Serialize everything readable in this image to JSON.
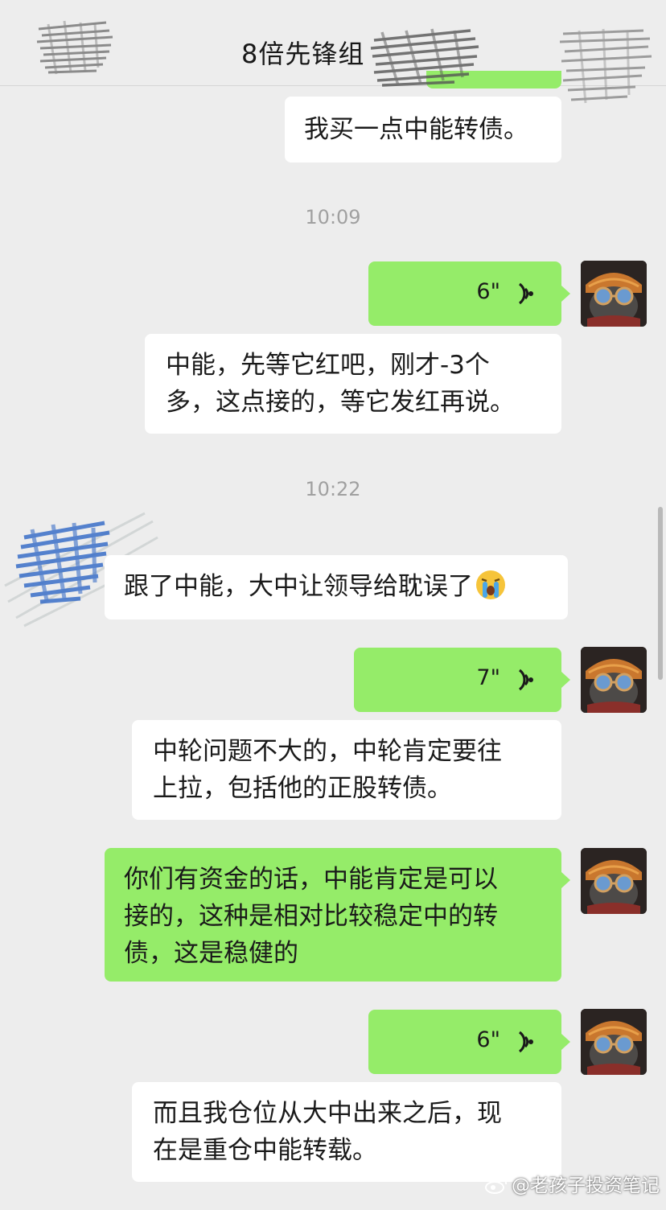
{
  "header": {
    "title": "8倍先锋组"
  },
  "messages": [
    {
      "type": "text",
      "side": "received",
      "lines": [
        "我买一点中能转债。"
      ]
    },
    {
      "type": "time",
      "text": "10:09"
    },
    {
      "type": "voice",
      "side": "sent",
      "duration": "6\""
    },
    {
      "type": "text",
      "side": "received",
      "lines": [
        "中能，先等它红吧，刚才-3个",
        "多，这点接的，等它发红再说。"
      ]
    },
    {
      "type": "time",
      "text": "10:22"
    },
    {
      "type": "text",
      "side": "received",
      "lines": [
        "跟了中能，大中让领导给耽误了"
      ],
      "emoji": "crying-face"
    },
    {
      "type": "voice",
      "side": "sent",
      "duration": "7\""
    },
    {
      "type": "text",
      "side": "received",
      "lines": [
        "中轮问题不大的，中轮肯定要往",
        "上拉，包括他的正股转债。"
      ]
    },
    {
      "type": "text",
      "side": "sent",
      "lines": [
        "你们有资金的话，中能肯定是可以",
        "接的，这种是相对比较稳定中的转",
        "债，这是稳健的"
      ]
    },
    {
      "type": "voice",
      "side": "sent",
      "duration": "6\""
    },
    {
      "type": "text",
      "side": "received",
      "lines": [
        "而且我仓位从大中出来之后，现",
        "在是重仓中能转载。"
      ]
    }
  ],
  "watermark": "@老孩子投资笔记",
  "colors": {
    "background": "#ededed",
    "sent_bubble": "#95ec69",
    "received_bubble": "#ffffff",
    "timestamp": "#a0a0a0"
  },
  "icons": {
    "voice": "voice-wave-icon",
    "avatar": "cat-avatar",
    "emoji": "crying-face-emoji",
    "watermark": "weibo-icon"
  }
}
